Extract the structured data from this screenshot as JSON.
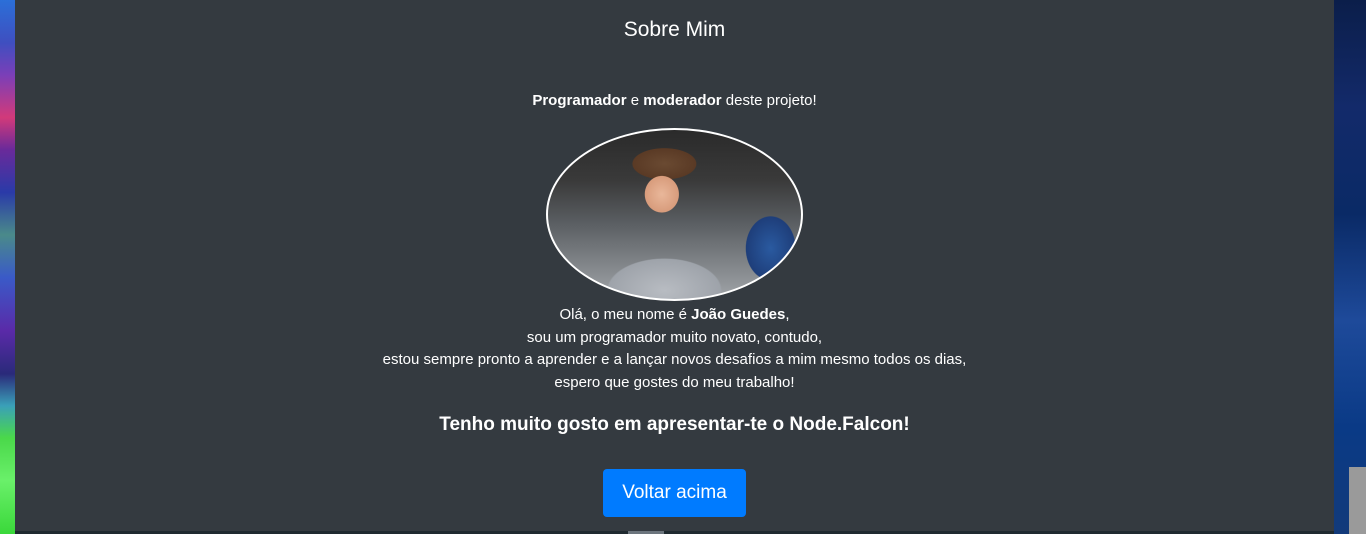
{
  "section": {
    "title": "Sobre Mim",
    "role": {
      "word1": "Programador",
      "connector": " e ",
      "word2": "moderador",
      "suffix": " deste projeto!"
    },
    "intro": {
      "line1_prefix": "Olá, o meu nome é ",
      "name": "João Guedes",
      "line1_suffix": ",",
      "line2": "sou um programador muito novato, contudo,",
      "line3": "estou sempre pronto a aprender e a lançar novos desafios a mim mesmo todos os dias,",
      "line4": "espero que gostes do meu trabalho!"
    },
    "tagline": "Tenho muito gosto em apresentar-te o Node.Falcon!",
    "button_label": "Voltar acima"
  },
  "colors": {
    "panel_bg": "#343a40",
    "button_bg": "#007bff",
    "text": "#ffffff"
  },
  "icons": {
    "profile_photo": "profile-photo"
  }
}
